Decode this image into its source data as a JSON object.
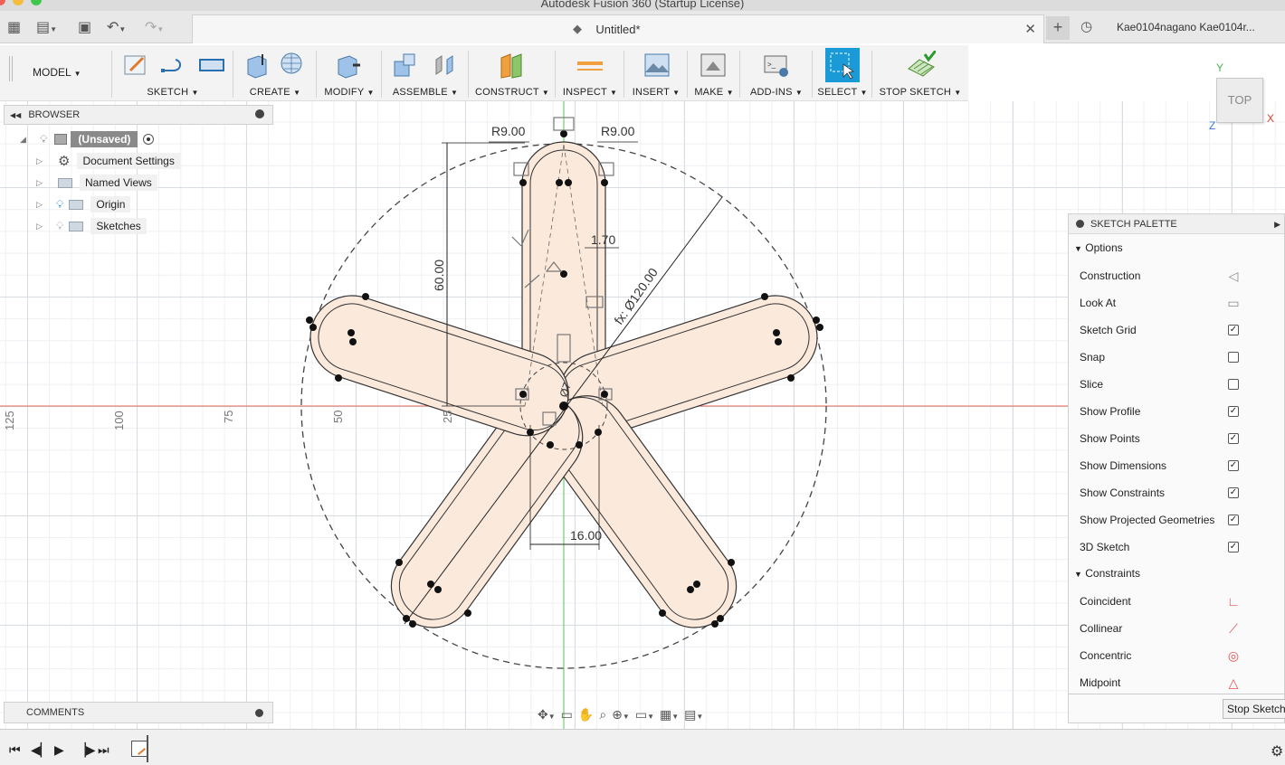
{
  "window": {
    "title": "Autodesk Fusion 360 (Startup License)"
  },
  "tab": {
    "title": "Untitled*",
    "user": "Kae0104nagano Kae0104r..."
  },
  "toolbar": {
    "workspace": "MODEL",
    "groups": [
      "SKETCH",
      "CREATE",
      "MODIFY",
      "ASSEMBLE",
      "CONSTRUCT",
      "INSPECT",
      "INSERT",
      "MAKE",
      "ADD-INS",
      "SELECT",
      "STOP SKETCH"
    ]
  },
  "browser": {
    "title": "BROWSER",
    "root": "(Unsaved)",
    "items": [
      "Document Settings",
      "Named Views",
      "Origin",
      "Sketches"
    ]
  },
  "sketch": {
    "dims": {
      "r_left": "R9.00",
      "r_right": "R9.00",
      "height": "60.00",
      "width": "16.00",
      "gap": "1.70",
      "diameter": "fx: Ø120.00",
      "small": "Ø7"
    }
  },
  "axis_labels": [
    "125",
    "100",
    "75",
    "50",
    "25"
  ],
  "viewcube": {
    "face": "TOP",
    "x": "X",
    "y": "Y",
    "z": "Z"
  },
  "palette": {
    "title": "SKETCH PALETTE",
    "options_title": "Options",
    "options": [
      {
        "label": "Construction",
        "kind": "icon",
        "icon": "construction-icon"
      },
      {
        "label": "Look At",
        "kind": "icon",
        "icon": "look-at-icon"
      },
      {
        "label": "Sketch Grid",
        "kind": "check",
        "checked": true
      },
      {
        "label": "Snap",
        "kind": "check",
        "checked": false
      },
      {
        "label": "Slice",
        "kind": "check",
        "checked": false
      },
      {
        "label": "Show Profile",
        "kind": "check",
        "checked": true
      },
      {
        "label": "Show Points",
        "kind": "check",
        "checked": true
      },
      {
        "label": "Show Dimensions",
        "kind": "check",
        "checked": true
      },
      {
        "label": "Show Constraints",
        "kind": "check",
        "checked": true
      },
      {
        "label": "Show Projected Geometries",
        "kind": "check",
        "checked": true
      },
      {
        "label": "3D Sketch",
        "kind": "check",
        "checked": true
      }
    ],
    "constraints_title": "Constraints",
    "constraints": [
      {
        "label": "Coincident",
        "icon": "coincident-icon"
      },
      {
        "label": "Collinear",
        "icon": "collinear-icon"
      },
      {
        "label": "Concentric",
        "icon": "concentric-icon"
      },
      {
        "label": "Midpoint",
        "icon": "midpoint-icon"
      }
    ],
    "stop_button": "Stop Sketch"
  },
  "comments": {
    "title": "COMMENTS"
  },
  "colors": {
    "accent": "#1a9bd7",
    "profile_fill": "#fbe9dc",
    "x_axis": "#e86a5a",
    "y_axis": "#5bc25b"
  }
}
